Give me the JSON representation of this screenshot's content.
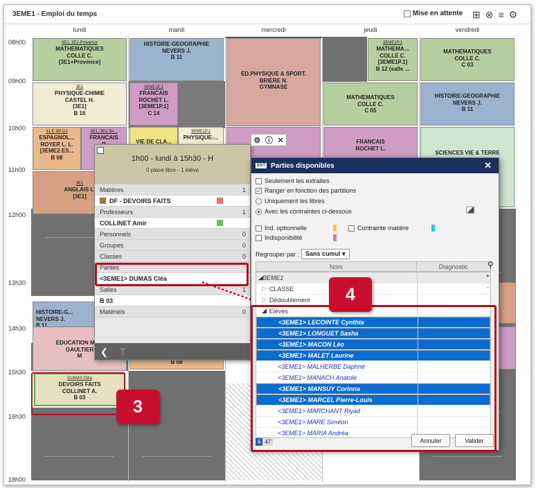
{
  "window": {
    "title": "3EME1 - Emploi du temps",
    "waiting_label": "Mise en attente"
  },
  "days": [
    "lundi",
    "mardi",
    "mercredi",
    "jeudi",
    "vendredi"
  ],
  "hours": [
    "08h00",
    "09h00",
    "10h00",
    "11h00",
    "12h00",
    "13h30",
    "14h30",
    "15h30",
    "16h30",
    "18h00"
  ],
  "courses": {
    "c1": {
      "small": "3E1, 3E1-Provence",
      "lines": [
        "MATHEMATIQUES",
        "COLLE C.",
        "[3E1+Provence]"
      ],
      "color": "#b6cf9f"
    },
    "c2": {
      "lines": [
        "HISTOIRE-GEOGRAPHIE",
        "NEVERS J.",
        "B 11"
      ],
      "color": "#9bb3cc"
    },
    "c3": {
      "lines": [
        "ED.PHYSIQUE & SPORT.",
        "BRIERE N.",
        "GYMNASE"
      ],
      "color": "#d8a79e"
    },
    "c4": {
      "small": "3EME1P.1",
      "lines": [
        "MATHEMA...",
        "COLLE C.",
        "[3EME1P.1]",
        "B 12 (salle ..."
      ],
      "color": "#b6cf9f"
    },
    "c5": {
      "lines": [
        "MATHEMATIQUES",
        "COLLE C.",
        "C 03"
      ],
      "color": "#b6cf9f"
    },
    "c6": {
      "small": "3E1",
      "lines": [
        "PHYSIQUE-CHIMIE",
        "CASTEL H.",
        "[3E1]",
        "B 16"
      ],
      "color": "#f1edd4"
    },
    "c7": {
      "small": "3EME1P.1",
      "lines": [
        "FRANCAIS",
        "ROCHET L.",
        "[3EME1P.1]",
        "C 14"
      ],
      "color": "#cf9cc5"
    },
    "c8": {
      "lines": [
        "MATHEMATIQUES",
        "COLLE C.",
        "C 05"
      ],
      "color": "#b6cf9f"
    },
    "c9": {
      "lines": [
        "HISTOIRE-GEOGRAPHIE",
        "NEVERS J.",
        "B 11"
      ],
      "color": "#9bb3cc"
    },
    "c10": {
      "small": "31 E SP G1",
      "lines": [
        "ESPAGNOL...",
        "ROYER L. L.",
        "[3EME2 ES...",
        "B 08"
      ],
      "color": "#e8b98d"
    },
    "c11": {
      "small": "3E1, 3E1-Se...",
      "lines": [
        "FRANCAIS",
        "R"
      ],
      "color": "#cf9cc5"
    },
    "c12": {
      "lines": [
        "VIE DE CLA..."
      ],
      "color": "#efe481"
    },
    "c13": {
      "small": "3EME1P.1",
      "lines": [
        "PHYSIQUE-..."
      ],
      "color": "#f1edd4"
    },
    "c14": {
      "lines": [
        "FRANCAIS",
        "ROCHET L."
      ],
      "color": "#cf9cc5"
    },
    "c15": {
      "lines": [
        "SCIENCES VIE & TERRE"
      ],
      "color": "#cfe6d0"
    },
    "c16": {
      "small": "3E1",
      "lines": [
        "ANGLAIS L.",
        "[3E1]"
      ],
      "color": "#d6a182"
    },
    "c17": {
      "lines": [
        "HISTOIRE-G...",
        "NEVERS J.",
        "B 11"
      ],
      "color": "#9bb3cc"
    },
    "c18": {
      "lines": [
        "EDUCATION MU...",
        "GAULTIER",
        "M"
      ],
      "color": "#e7bfbf"
    },
    "c19": {
      "small": "DUMAS Cléa",
      "lines": [
        "DEVOIRS FAITS",
        "COLLINET A.",
        "B 03"
      ],
      "color": "#e6e0c0"
    },
    "c20": {
      "lines": [
        "B 08"
      ],
      "color": "#e8b98d"
    }
  },
  "popup": {
    "time": "1h00 - lundi à 15h30 - H",
    "places": "0 place libre - 1 élève",
    "rows": [
      {
        "label": "Matières",
        "count": "1",
        "type": "sec"
      },
      {
        "label": "DF - DEVOIRS FAITS",
        "type": "val",
        "color": "#e57373"
      },
      {
        "label": "Professeurs",
        "count": "1",
        "type": "sec"
      },
      {
        "label": "COLLINET Amir",
        "type": "val",
        "color": "#6ec05a"
      },
      {
        "label": "Personnels",
        "count": "0",
        "type": "sec"
      },
      {
        "label": "Groupes",
        "count": "0",
        "type": "sec"
      },
      {
        "label": "Classes",
        "count": "0",
        "type": "sec"
      },
      {
        "label": "Parties",
        "count": "",
        "type": "sec"
      },
      {
        "label": "<3EME1> DUMAS Cléa",
        "type": "val"
      },
      {
        "label": "Salles",
        "count": "1",
        "type": "sec"
      },
      {
        "label": "B 03",
        "type": "val"
      },
      {
        "label": "Matériels",
        "count": "0",
        "type": "sec"
      }
    ]
  },
  "dialog": {
    "title": "Parties disponibles",
    "logo": "EDT",
    "opt_extraites": "Seulement les extraites",
    "opt_ranger": "Ranger en fonction des partitions",
    "opt_libres": "Uniquement les libres",
    "opt_contraintes": "Avec les contraintes ci-dessous",
    "opt_ind": "Ind. optionnelle",
    "opt_matiere": "Contrainte matière",
    "opt_indispo": "Indisponibilité",
    "groupby_label": "Regrouper par :",
    "groupby_value": "Sans cumul",
    "col_nom": "Nom",
    "col_diag": "Diagnostic",
    "groups": [
      "3EME1",
      "CLASSE",
      "Dédoublement",
      "Elèves"
    ],
    "students": [
      {
        "name": "<3EME1> LECOINTE Cynthia",
        "sel": true
      },
      {
        "name": "<3EME1> LONGUET Sasha",
        "sel": true
      },
      {
        "name": "<3EME1> MACON Léo",
        "sel": true
      },
      {
        "name": "<3EME1> MALET Laurine",
        "sel": true
      },
      {
        "name": "<3EME1> MALHERBE Daphné",
        "sel": false
      },
      {
        "name": "<3EME1> MANACH Anatole",
        "sel": false
      },
      {
        "name": "<3EME1> MANSUY Corinna",
        "sel": true
      },
      {
        "name": "<3EME1> MARCEL Pierre-Louis",
        "sel": true
      },
      {
        "name": "<3EME1> MARCHANT Riyad",
        "sel": false
      },
      {
        "name": "<3EME1> MARE Siméon",
        "sel": false
      },
      {
        "name": "<3EME1> MARIA Andréa",
        "sel": false
      }
    ],
    "count_sel": "6",
    "count_total": "47",
    "cancel": "Annuler",
    "ok": "Valider"
  },
  "markers": {
    "m3": "3",
    "m4": "4"
  }
}
